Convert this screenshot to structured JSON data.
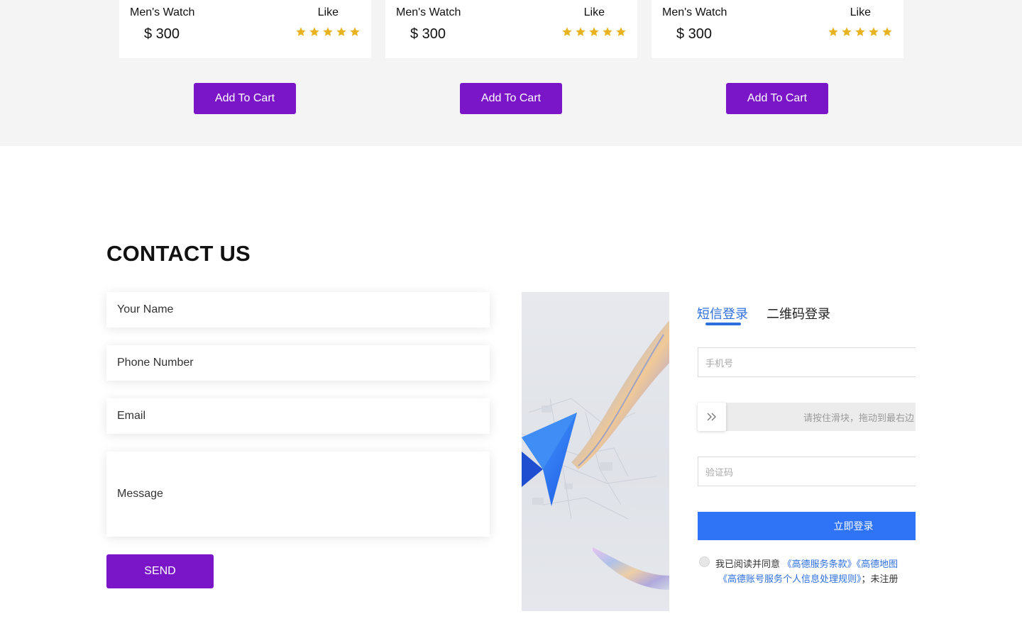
{
  "products": [
    {
      "name": "Men's Watch",
      "like": "Like",
      "price": "$ 300",
      "rating": 5,
      "button": "Add To Cart"
    },
    {
      "name": "Men's Watch",
      "like": "Like",
      "price": "$ 300",
      "rating": 5,
      "button": "Add To Cart"
    },
    {
      "name": "Men's Watch",
      "like": "Like",
      "price": "$ 300",
      "rating": 5,
      "button": "Add To Cart"
    }
  ],
  "colors": {
    "accent_purple": "#7b16c8",
    "star_gold": "#e8b21e",
    "login_blue": "#2f73f6",
    "link_blue": "#2e6fde"
  },
  "contact": {
    "title": "CONTACT US",
    "name_placeholder": "Your Name",
    "phone_placeholder": "Phone Number",
    "email_placeholder": "Email",
    "message_placeholder": "Message",
    "send_label": "SEND"
  },
  "login": {
    "tabs": [
      "短信登录",
      "二维码登录"
    ],
    "active_tab": "短信登录",
    "phone_placeholder": "手机号",
    "slider_hint": "请按住滑块，拖动到最右边",
    "slider_icon": "double-chevron-right-icon",
    "code_placeholder": "验证码",
    "submit_label": "立即登录",
    "agree_prefix": "我已阅读并同意",
    "agree_link1": "《高德服务条款》",
    "agree_link2": "《高德地图",
    "agree_link3": "《高德账号服务个人信息处理规则》",
    "agree_suffix": "；未注册"
  }
}
